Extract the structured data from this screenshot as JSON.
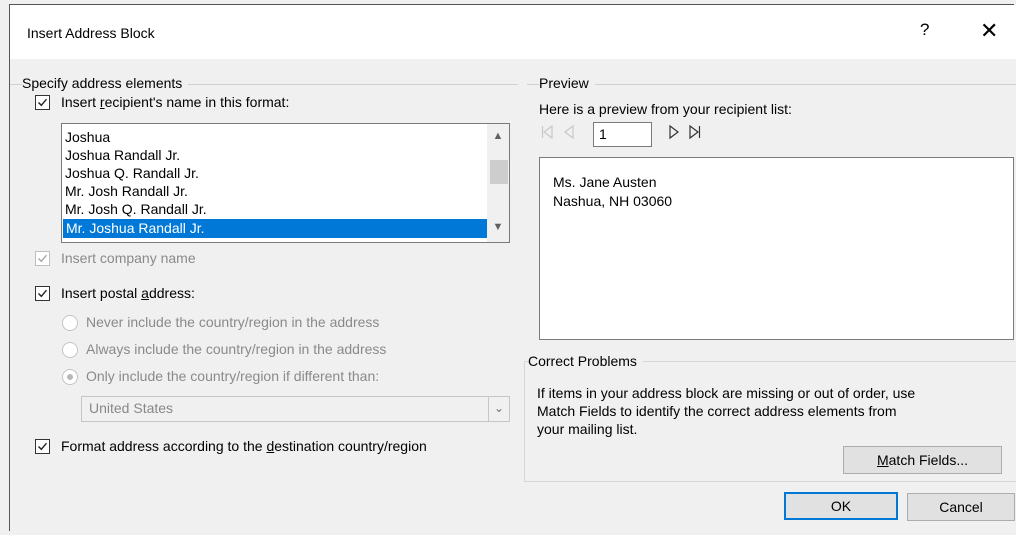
{
  "dialog": {
    "title": "Insert Address Block",
    "help_label": "?",
    "close_label": "✕"
  },
  "left": {
    "group_label": "Specify address elements",
    "recipient_name": {
      "checked": true,
      "pre": "Insert ",
      "u": "r",
      "post": "ecipient's name in this format:"
    },
    "name_formats": [
      "Joshua",
      "Joshua Randall Jr.",
      "Joshua Q. Randall Jr.",
      "Mr. Josh Randall Jr.",
      "Mr. Josh Q. Randall Jr.",
      "Mr. Joshua Randall Jr."
    ],
    "selected_format": "Mr. Joshua Randall Jr.",
    "company_name": {
      "checked": true,
      "disabled": true,
      "label": "Insert company name"
    },
    "postal_address": {
      "checked": true,
      "pre": "Insert postal ",
      "u": "a",
      "post": "ddress:"
    },
    "country_options": [
      "Never include the country/region in the address",
      "Always include the country/region in the address",
      "Only include the country/region if different than:"
    ],
    "selected_country_option": 2,
    "country_value": "United States",
    "format_destination": {
      "checked": true,
      "pre": "Format address according to the ",
      "u": "d",
      "post": "estination country/region"
    }
  },
  "preview": {
    "group_label": "Preview",
    "subtitle": "Here is a preview from your recipient list:",
    "record_number": "1",
    "lines": [
      "Ms. Jane Austen",
      "Nashua, NH 03060"
    ]
  },
  "correct": {
    "group_label": "Correct Problems",
    "text_lines": [
      "If items in your address block are missing or out of order, use",
      "Match Fields to identify the correct address elements from",
      "your mailing list."
    ],
    "match_pre": "",
    "match_u": "M",
    "match_post": "atch Fields..."
  },
  "buttons": {
    "ok": "OK",
    "cancel": "Cancel"
  }
}
